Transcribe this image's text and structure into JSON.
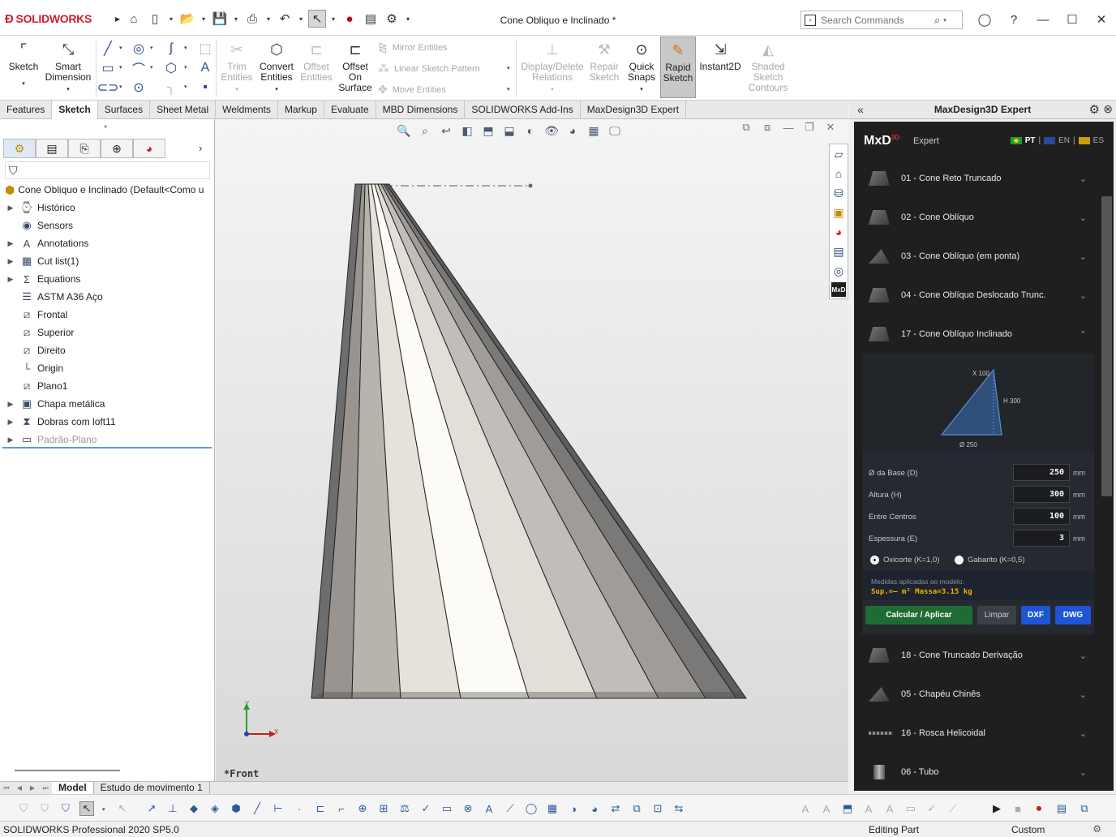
{
  "app": {
    "logo_text": "SOLIDWORKS",
    "document_title": "Cone Obliquo e Inclinado *"
  },
  "search": {
    "placeholder": "Search Commands"
  },
  "ribbon": {
    "sketch": "Sketch",
    "smart_dimension": [
      "Smart",
      "Dimension"
    ],
    "trim_entities": [
      "Trim",
      "Entities"
    ],
    "convert_entities": [
      "Convert",
      "Entities"
    ],
    "offset_entities": [
      "Offset",
      "Entities"
    ],
    "offset_on_surface": [
      "Offset",
      "On",
      "Surface"
    ],
    "mirror_entities": "Mirror Entities",
    "linear_sketch_pattern": "Linear Sketch Pattern",
    "move_entities": "Move Entities",
    "display_delete_relations": [
      "Display/Delete",
      "Relations"
    ],
    "repair_sketch": [
      "Repair",
      "Sketch"
    ],
    "quick_snaps": [
      "Quick",
      "Snaps"
    ],
    "rapid_sketch": [
      "Rapid",
      "Sketch"
    ],
    "instant2d": "Instant2D",
    "shaded_sketch_contours": [
      "Shaded",
      "Sketch",
      "Contours"
    ]
  },
  "command_tabs": [
    "Features",
    "Sketch",
    "Surfaces",
    "Sheet Metal",
    "Weldments",
    "Markup",
    "Evaluate",
    "MBD Dimensions",
    "SOLIDWORKS Add-Ins",
    "MaxDesign3D Expert"
  ],
  "command_tabs_active": 1,
  "tree": {
    "root": "Cone Obliquo e Inclinado  (Default<Como u",
    "items": [
      {
        "label": "Histórico",
        "icon": "history-folder-icon",
        "arrow": true
      },
      {
        "label": "Sensors",
        "icon": "sensors-folder-icon",
        "arrow": false
      },
      {
        "label": "Annotations",
        "icon": "annotations-icon",
        "arrow": true
      },
      {
        "label": "Cut list(1)",
        "icon": "cut-list-icon",
        "arrow": true
      },
      {
        "label": "Equations",
        "icon": "equations-icon",
        "arrow": true
      },
      {
        "label": "ASTM A36 Aço",
        "icon": "material-icon",
        "arrow": false
      },
      {
        "label": "Frontal",
        "icon": "plane-icon",
        "arrow": false
      },
      {
        "label": "Superior",
        "icon": "plane-icon",
        "arrow": false
      },
      {
        "label": "Direito",
        "icon": "plane-icon",
        "arrow": false
      },
      {
        "label": "Origin",
        "icon": "origin-icon",
        "arrow": false
      },
      {
        "label": "Plano1",
        "icon": "plane-icon",
        "arrow": false
      },
      {
        "label": "Chapa metálica",
        "icon": "sheet-metal-icon",
        "arrow": true
      },
      {
        "label": "Dobras com loft11",
        "icon": "lofted-bend-icon",
        "arrow": true
      },
      {
        "label": "Padrão-Plano",
        "icon": "flat-pattern-icon",
        "arrow": true,
        "greyed": true
      }
    ]
  },
  "bottom_tabs": [
    "Model",
    "Estudo de movimento 1"
  ],
  "viewport": {
    "view_name": "*Front",
    "triad_y": "Y",
    "triad_x": "X"
  },
  "task_pane": {
    "title": "MaxDesign3D Expert",
    "brand": "MxD",
    "brand_sup": "3D",
    "subtitle": "Expert",
    "languages": [
      "PT",
      "EN",
      "ES"
    ],
    "language_active": "PT",
    "items_top": [
      {
        "label": "01 - Cone Reto Truncado",
        "icon": "truncated-cone-icon"
      },
      {
        "label": "02 - Cone Oblíquo",
        "icon": "oblique-cone-icon"
      },
      {
        "label": "03 - Cone Oblíquo (em ponta)",
        "icon": "pointed-cone-icon"
      },
      {
        "label": "04 - Cone Oblíquo Deslocado Trunc.",
        "icon": "offset-cone-icon"
      },
      {
        "label": "17 - Cone Oblíquo Inclinado",
        "icon": "inclined-cone-icon",
        "expanded": true
      }
    ],
    "diagram": {
      "top_label": "X 100",
      "height_label": "H 300",
      "base_label": "Ø 250"
    },
    "fields": [
      {
        "label": "Ø da Base (D)",
        "value": "250",
        "unit": "mm"
      },
      {
        "label": "Altura (H)",
        "value": "300",
        "unit": "mm"
      },
      {
        "label": "Entre Centros",
        "value": "100",
        "unit": "mm"
      },
      {
        "label": "Espessura (E)",
        "value": "3",
        "unit": "mm"
      }
    ],
    "radio_options": [
      {
        "label": "Oxicorte (K=1,0)",
        "selected": true
      },
      {
        "label": "Gabarito (K=0,5)",
        "selected": false
      }
    ],
    "result_note": "Medidas aplicadas ao modelo.",
    "result_values": "Sup.=— m²   Massa=3.15 kg",
    "buttons": {
      "apply": "Calcular / Aplicar",
      "clear": "Limpar",
      "dxf": "DXF",
      "dwg": "DWG"
    },
    "items_bottom": [
      {
        "label": "18 - Cone Truncado Derivação",
        "icon": "branch-cone-icon"
      },
      {
        "label": "05 - Chapéu Chinês",
        "icon": "chinese-hat-icon"
      },
      {
        "label": "16 - Rosca Helicoidal",
        "icon": "helical-thread-icon"
      },
      {
        "label": "06 - Tubo",
        "icon": "tube-icon"
      }
    ]
  },
  "status": {
    "product": "SOLIDWORKS Professional 2020 SP5.0",
    "mode": "Editing Part",
    "units": "Custom"
  },
  "colors": {
    "brand_red": "#d0202a",
    "apply_green": "#1f6b34",
    "dxf_blue": "#1e55d6",
    "result_orange": "#f0b000"
  }
}
